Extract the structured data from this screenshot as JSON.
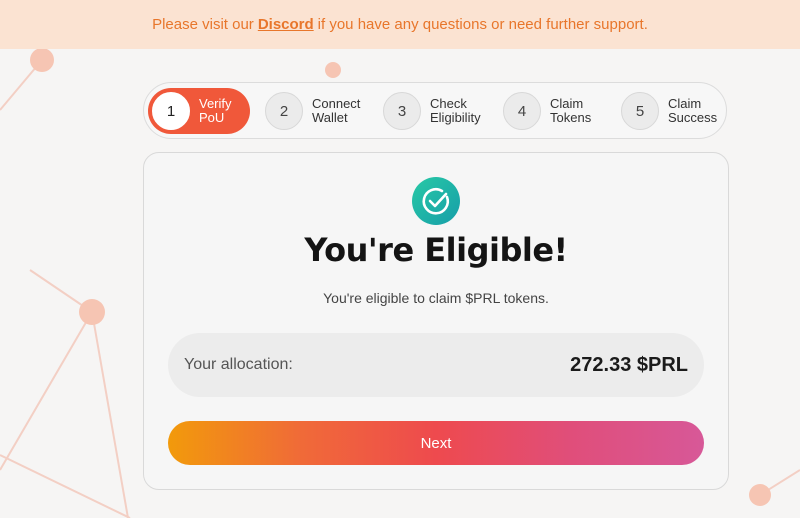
{
  "banner": {
    "text_before": "Please visit our",
    "link_text": "Discord",
    "text_after": "if you have any questions or need further support.",
    "color": "#e8762b",
    "background": "#fbe3d2"
  },
  "steps": [
    {
      "number": "1",
      "label": "Verify\nPoU",
      "state": "active"
    },
    {
      "number": "2",
      "label": "Connect\nWallet",
      "state": "pending"
    },
    {
      "number": "3",
      "label": "Check\nEligibility",
      "state": "pending"
    },
    {
      "number": "4",
      "label": "Claim\nTokens",
      "state": "pending"
    },
    {
      "number": "5",
      "label": "Claim\nSuccess",
      "state": "pending"
    }
  ],
  "card": {
    "icon": "check-circle-icon",
    "title": "You're Eligible!",
    "subtitle": "You're eligible to claim $PRL tokens.",
    "allocation_label": "Your allocation:",
    "allocation_value": "272.33 $PRL",
    "next_button": "Next"
  },
  "colors": {
    "accent": "#f0583a",
    "success": "#1fb5a7",
    "button_gradient_start": "#f29a0b",
    "button_gradient_end": "#d75898"
  }
}
